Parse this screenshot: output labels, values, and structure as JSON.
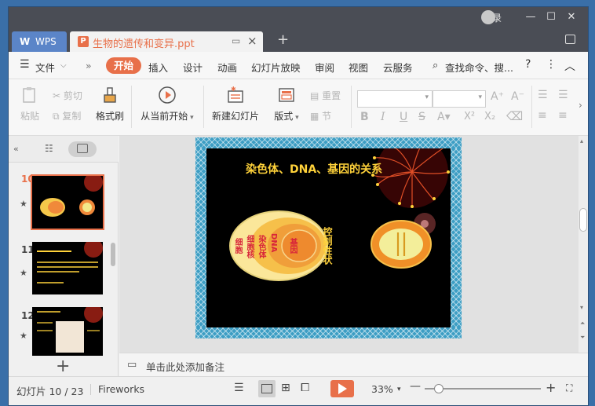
{
  "window": {
    "login_label": "登录",
    "controls": [
      "minimize-icon",
      "maximize-icon",
      "close-icon"
    ]
  },
  "tabs": {
    "app_tab": "WPS",
    "doc_tab": "生物的遗传和变异.ppt"
  },
  "menu": {
    "file": "文件",
    "items": [
      "开始",
      "插入",
      "设计",
      "动画",
      "幻灯片放映",
      "审阅",
      "视图",
      "云服务"
    ],
    "search": "查找命令、搜..."
  },
  "ribbon": {
    "paste": "粘贴",
    "cut": "剪切",
    "copy": "复制",
    "format_painter": "格式刷",
    "play_from_current": "从当前开始",
    "new_slide": "新建幻灯片",
    "layout": "版式",
    "reset": "重置",
    "section": "节"
  },
  "slides": [
    {
      "number": "10",
      "selected": true
    },
    {
      "number": "11",
      "selected": false
    },
    {
      "number": "12",
      "selected": false
    }
  ],
  "slide": {
    "title": "染色体、DNA、基因的关系",
    "ring_labels": [
      "细胞",
      "细胞核",
      "染色体",
      "DNA",
      "基因"
    ],
    "control_label": "控制性状"
  },
  "notes": {
    "placeholder": "单击此处添加备注"
  },
  "status": {
    "slide_counter": "幻灯片 10 / 23",
    "theme": "Fireworks",
    "zoom": "33%"
  },
  "colors": {
    "accent": "#e8704a",
    "titlebar": "#4a4d55",
    "slide_border": "#3d9ec4"
  }
}
